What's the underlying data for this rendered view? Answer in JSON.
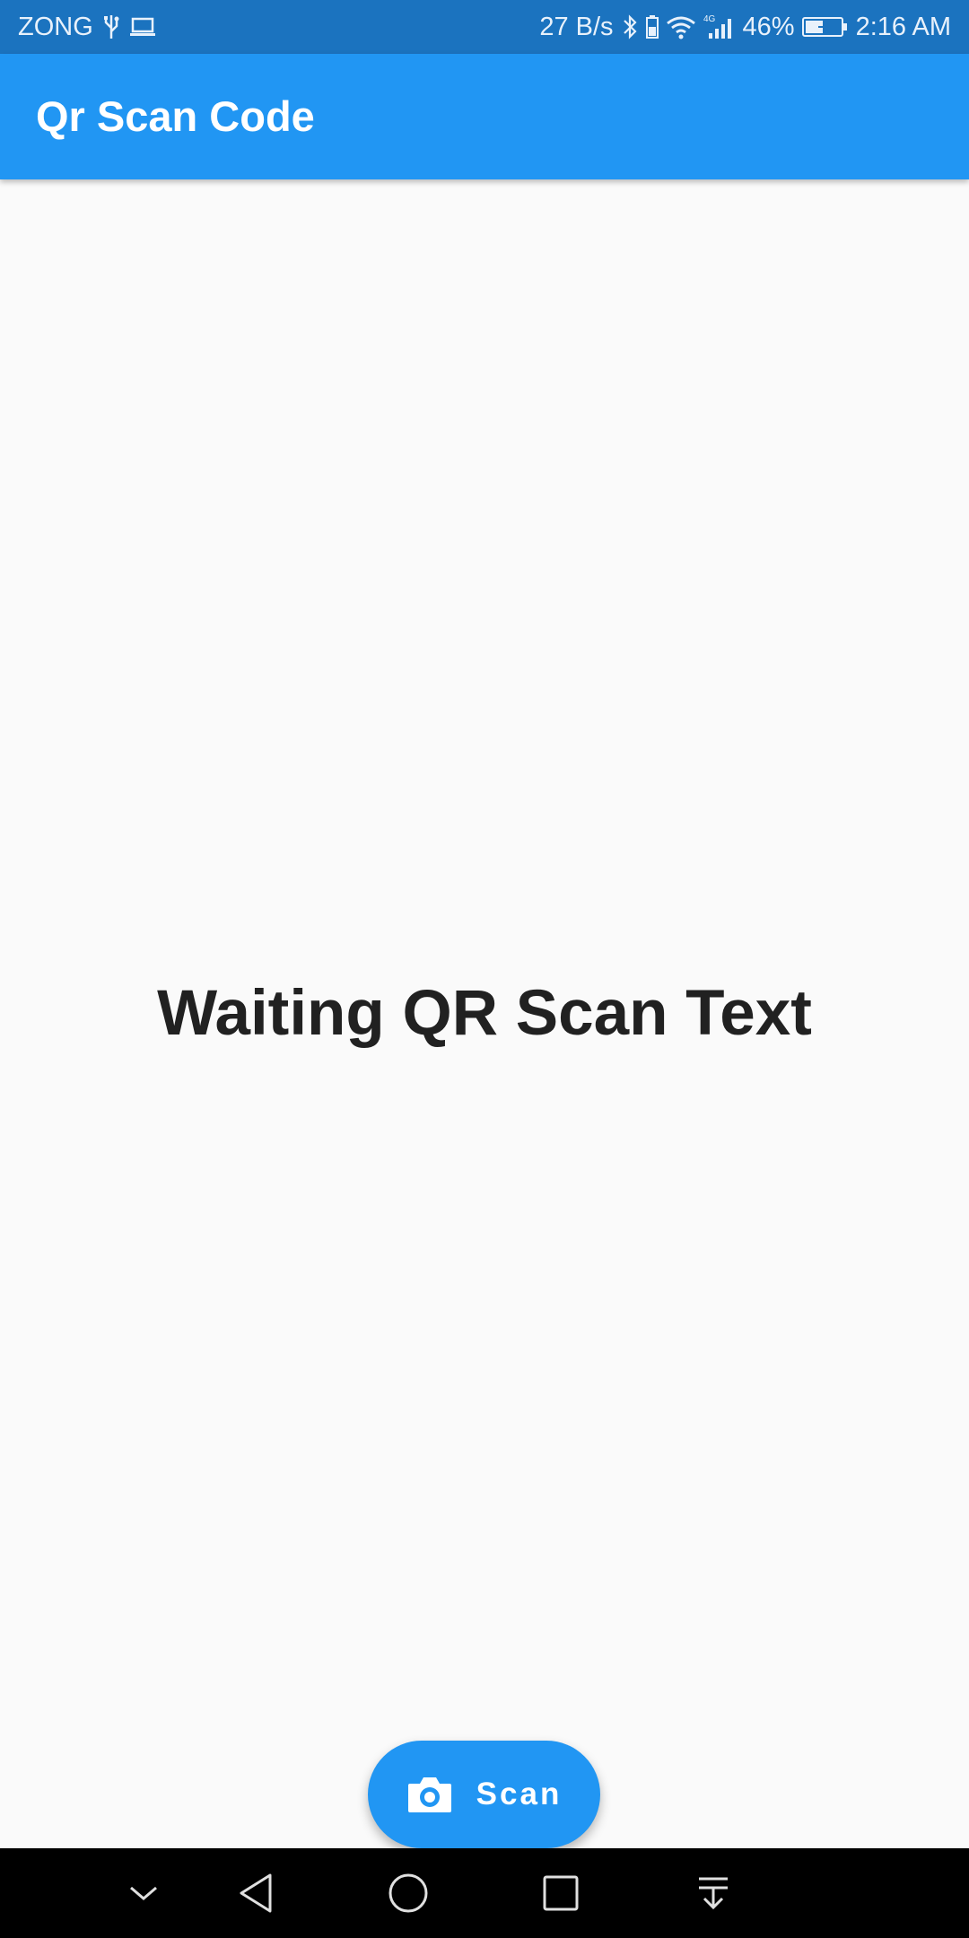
{
  "status_bar": {
    "carrier": "ZONG",
    "net_speed": "27 B/s",
    "network_type": "4G",
    "battery": "46%",
    "time": "2:16 AM",
    "icons": [
      "usb-icon",
      "laptop-icon",
      "bluetooth-icon",
      "wifi-icon",
      "signal-icon",
      "battery-icon"
    ]
  },
  "app_bar": {
    "title": "Qr Scan Code",
    "color": "#2196f3"
  },
  "main": {
    "message": "Waiting QR Scan Text"
  },
  "fab": {
    "label": "Scan",
    "icon": "camera-icon",
    "color": "#2196f3"
  },
  "nav_bar": {
    "buttons": [
      "chevron-down-icon",
      "back-icon",
      "home-icon",
      "recents-icon",
      "notification-pull-icon"
    ]
  }
}
